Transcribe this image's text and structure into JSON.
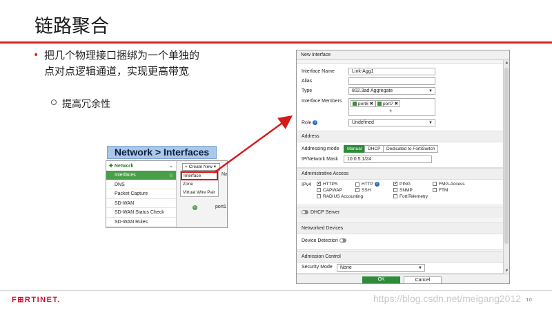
{
  "slide": {
    "title": "链路聚合",
    "bullet_line1": "把几个物理接口捆绑为一个单独的",
    "bullet_line2": "点对点逻辑通道，实现更高带宽",
    "sub_bullet": "提高冗余性",
    "footer_brand": "F⊞RTINET.",
    "watermark": "https://blog.csdn.net/meigang2012",
    "page_number": "10"
  },
  "network_snippet": {
    "label": "Network > Interfaces",
    "menu_header": "Network",
    "menu_items": [
      "Interfaces",
      "DNS",
      "Packet Capture",
      "SD-WAN",
      "SD-WAN Status Check",
      "SD-WAN Rules"
    ],
    "create_new": "Create New",
    "dropdown_items": [
      "Interface",
      "Zone",
      "Virtual Wire Pair"
    ],
    "column_header": "Na",
    "port_label": "port1"
  },
  "dialog": {
    "title": "New Interface",
    "fields": {
      "interface_name_label": "Interface Name",
      "interface_name_value": "Link-Agg1",
      "alias_label": "Alias",
      "type_label": "Type",
      "type_value": "802.3ad Aggregate",
      "members_label": "Interface Members",
      "members": [
        "port6",
        "port7"
      ],
      "add_member": "+",
      "role_label": "Role",
      "role_value": "Undefined"
    },
    "address": {
      "section": "Address",
      "mode_label": "Addressing mode",
      "modes": [
        "Manual",
        "DHCP",
        "Dedicated to FortiSwitch"
      ],
      "ip_label": "IP/Network Mask",
      "ip_value": "10.0.5.1/24"
    },
    "admin_access": {
      "section": "Administrative Access",
      "ipv4_label": "IPv4",
      "https": "HTTPS",
      "http": "HTTP",
      "ping": "PING",
      "fmg": "FMG-Access",
      "capwap": "CAPWAP",
      "ssh": "SSH",
      "snmp": "SNMP",
      "ftm": "FTM",
      "radius": "RADIUS Accounting",
      "fortitelemetry": "FortiTelemetry"
    },
    "dhcp_server": "DHCP Server",
    "networked_devices": {
      "section": "Networked Devices",
      "device_detection": "Device Detection"
    },
    "admission_control": {
      "section": "Admission Control",
      "security_mode_label": "Security Mode",
      "security_mode_value": "None"
    },
    "buttons": {
      "ok": "OK",
      "cancel": "Cancel"
    }
  }
}
